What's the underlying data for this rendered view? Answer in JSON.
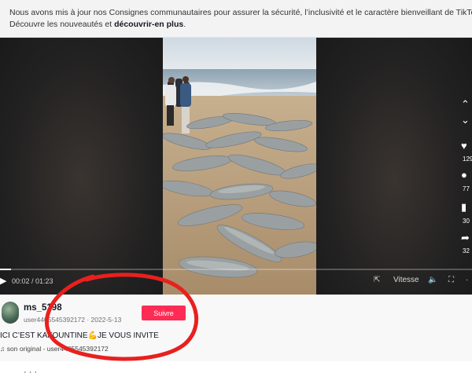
{
  "banner": {
    "line1": "Nous avons mis à jour nos Consignes communautaires pour assurer la sécurité, l’inclusivité et le caractère bienveillant de TikTok.",
    "line2_prefix": "Découvre les nouveautés et",
    "line2_link": "découvrir-en plus",
    "line2_suffix": "."
  },
  "player": {
    "time_current": "00:02",
    "time_total": "01:23",
    "time_text": "00:02 / 01:23",
    "progress_fraction": 0.024,
    "speed_label": "Vitesse",
    "side_counts": [
      "129",
      "77",
      "30",
      "32"
    ]
  },
  "author": {
    "username": "ms_5198",
    "subline": "user4405545392172 · 2022-5-13",
    "follow_label": "Suivre"
  },
  "caption": "ICI C’EST KAFOUNTINE💪JE VOUS INVITE",
  "sound": "son original - user4405545392172",
  "footer_peek": "· · ·",
  "colors": {
    "follow": "#fe2c55",
    "annotation_circle": "#e8201e"
  },
  "icons": {
    "like": "heart-icon",
    "comment": "comment-icon",
    "save": "bookmark-icon",
    "share": "share-icon",
    "play": "play-icon",
    "volume": "volume-icon",
    "fullscreen": "fullscreen-icon"
  }
}
